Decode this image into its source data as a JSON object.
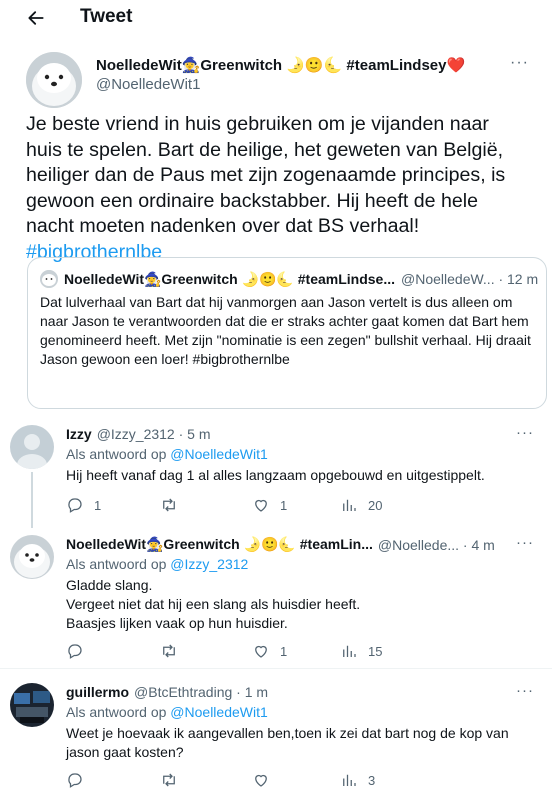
{
  "header": {
    "title": "Tweet"
  },
  "main_tweet": {
    "author_name": "NoelledeWit🧙‍♀️Greenwitch 🌛🙂🌜 #teamLindsey❤️",
    "handle": "@NoelledeWit1",
    "text": "Je beste vriend in huis gebruiken om je vijanden naar huis te spelen. Bart de heilige, het geweten van België, heiliger dan de Paus met zijn zogenaamde principes, is gewoon een ordinaire backstabber. Hij heeft de hele nacht moeten nadenken over dat BS verhaal!",
    "hashtag": "#bigbrothernlbe",
    "more": "···"
  },
  "quote": {
    "author_name": "NoelledeWit🧙‍♀️Greenwitch 🌛🙂🌜 #teamLindse...",
    "meta": "@NoelledeW... · 12 m",
    "text": "Dat lulverhaal van Bart dat hij vanmorgen aan Jason vertelt is dus alleen om naar Jason te verantwoorden dat die er straks achter gaat komen dat Bart hem genomineerd heeft. Met zijn \"nominatie is een zegen\" bullshit verhaal. Hij draait Jason gewoon een loer!  #bigbrothernlbe"
  },
  "replies": [
    {
      "name": "Izzy",
      "meta": "@Izzy_2312 · 5 m",
      "replying_prefix": "Als antwoord op",
      "replying_to": "@NoelledeWit1",
      "text_lines": [
        "Hij heeft vanaf dag 1 al alles langzaam opgebouwd en uitgestippelt."
      ],
      "replies_count": "1",
      "retweets_count": "",
      "likes_count": "1",
      "views_count": "20"
    },
    {
      "name": "NoelledeWit🧙‍♀️Greenwitch 🌛🙂🌜 #teamLin...",
      "meta": "@Noellede... · 4 m",
      "replying_prefix": "Als antwoord op",
      "replying_to": "@Izzy_2312",
      "text_lines": [
        "Gladde slang.",
        "Vergeet niet dat hij een slang als huisdier heeft.",
        "Baasjes lijken vaak op hun huisdier."
      ],
      "replies_count": "",
      "retweets_count": "",
      "likes_count": "1",
      "views_count": "15"
    },
    {
      "name": "guillermo",
      "meta": "@BtcEthtrading · 1 m",
      "replying_prefix": "Als antwoord op",
      "replying_to": "@NoelledeWit1",
      "text_lines": [
        "Weet je hoevaak ik aangevallen ben,toen ik zei dat bart nog de kop van",
        "jason gaat kosten?"
      ],
      "replies_count": "",
      "retweets_count": "",
      "likes_count": "",
      "views_count": "3"
    }
  ],
  "more_label": "···",
  "icons": [
    "back-arrow-icon",
    "reply-icon",
    "retweet-icon",
    "like-icon",
    "views-icon",
    "more-icon"
  ],
  "colors": {
    "accent": "#1d9bf0",
    "secondary_text": "#536471",
    "border": "#cfd9de"
  }
}
